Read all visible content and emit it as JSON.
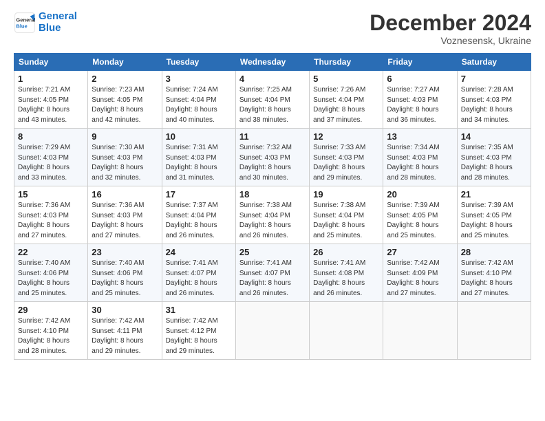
{
  "header": {
    "logo_line1": "General",
    "logo_line2": "Blue",
    "month_title": "December 2024",
    "subtitle": "Voznesensk, Ukraine"
  },
  "days_of_week": [
    "Sunday",
    "Monday",
    "Tuesday",
    "Wednesday",
    "Thursday",
    "Friday",
    "Saturday"
  ],
  "weeks": [
    [
      {
        "day": "1",
        "info": "Sunrise: 7:21 AM\nSunset: 4:05 PM\nDaylight: 8 hours\nand 43 minutes."
      },
      {
        "day": "2",
        "info": "Sunrise: 7:23 AM\nSunset: 4:05 PM\nDaylight: 8 hours\nand 42 minutes."
      },
      {
        "day": "3",
        "info": "Sunrise: 7:24 AM\nSunset: 4:04 PM\nDaylight: 8 hours\nand 40 minutes."
      },
      {
        "day": "4",
        "info": "Sunrise: 7:25 AM\nSunset: 4:04 PM\nDaylight: 8 hours\nand 38 minutes."
      },
      {
        "day": "5",
        "info": "Sunrise: 7:26 AM\nSunset: 4:04 PM\nDaylight: 8 hours\nand 37 minutes."
      },
      {
        "day": "6",
        "info": "Sunrise: 7:27 AM\nSunset: 4:03 PM\nDaylight: 8 hours\nand 36 minutes."
      },
      {
        "day": "7",
        "info": "Sunrise: 7:28 AM\nSunset: 4:03 PM\nDaylight: 8 hours\nand 34 minutes."
      }
    ],
    [
      {
        "day": "8",
        "info": "Sunrise: 7:29 AM\nSunset: 4:03 PM\nDaylight: 8 hours\nand 33 minutes."
      },
      {
        "day": "9",
        "info": "Sunrise: 7:30 AM\nSunset: 4:03 PM\nDaylight: 8 hours\nand 32 minutes."
      },
      {
        "day": "10",
        "info": "Sunrise: 7:31 AM\nSunset: 4:03 PM\nDaylight: 8 hours\nand 31 minutes."
      },
      {
        "day": "11",
        "info": "Sunrise: 7:32 AM\nSunset: 4:03 PM\nDaylight: 8 hours\nand 30 minutes."
      },
      {
        "day": "12",
        "info": "Sunrise: 7:33 AM\nSunset: 4:03 PM\nDaylight: 8 hours\nand 29 minutes."
      },
      {
        "day": "13",
        "info": "Sunrise: 7:34 AM\nSunset: 4:03 PM\nDaylight: 8 hours\nand 28 minutes."
      },
      {
        "day": "14",
        "info": "Sunrise: 7:35 AM\nSunset: 4:03 PM\nDaylight: 8 hours\nand 28 minutes."
      }
    ],
    [
      {
        "day": "15",
        "info": "Sunrise: 7:36 AM\nSunset: 4:03 PM\nDaylight: 8 hours\nand 27 minutes."
      },
      {
        "day": "16",
        "info": "Sunrise: 7:36 AM\nSunset: 4:03 PM\nDaylight: 8 hours\nand 27 minutes."
      },
      {
        "day": "17",
        "info": "Sunrise: 7:37 AM\nSunset: 4:04 PM\nDaylight: 8 hours\nand 26 minutes."
      },
      {
        "day": "18",
        "info": "Sunrise: 7:38 AM\nSunset: 4:04 PM\nDaylight: 8 hours\nand 26 minutes."
      },
      {
        "day": "19",
        "info": "Sunrise: 7:38 AM\nSunset: 4:04 PM\nDaylight: 8 hours\nand 25 minutes."
      },
      {
        "day": "20",
        "info": "Sunrise: 7:39 AM\nSunset: 4:05 PM\nDaylight: 8 hours\nand 25 minutes."
      },
      {
        "day": "21",
        "info": "Sunrise: 7:39 AM\nSunset: 4:05 PM\nDaylight: 8 hours\nand 25 minutes."
      }
    ],
    [
      {
        "day": "22",
        "info": "Sunrise: 7:40 AM\nSunset: 4:06 PM\nDaylight: 8 hours\nand 25 minutes."
      },
      {
        "day": "23",
        "info": "Sunrise: 7:40 AM\nSunset: 4:06 PM\nDaylight: 8 hours\nand 25 minutes."
      },
      {
        "day": "24",
        "info": "Sunrise: 7:41 AM\nSunset: 4:07 PM\nDaylight: 8 hours\nand 26 minutes."
      },
      {
        "day": "25",
        "info": "Sunrise: 7:41 AM\nSunset: 4:07 PM\nDaylight: 8 hours\nand 26 minutes."
      },
      {
        "day": "26",
        "info": "Sunrise: 7:41 AM\nSunset: 4:08 PM\nDaylight: 8 hours\nand 26 minutes."
      },
      {
        "day": "27",
        "info": "Sunrise: 7:42 AM\nSunset: 4:09 PM\nDaylight: 8 hours\nand 27 minutes."
      },
      {
        "day": "28",
        "info": "Sunrise: 7:42 AM\nSunset: 4:10 PM\nDaylight: 8 hours\nand 27 minutes."
      }
    ],
    [
      {
        "day": "29",
        "info": "Sunrise: 7:42 AM\nSunset: 4:10 PM\nDaylight: 8 hours\nand 28 minutes."
      },
      {
        "day": "30",
        "info": "Sunrise: 7:42 AM\nSunset: 4:11 PM\nDaylight: 8 hours\nand 29 minutes."
      },
      {
        "day": "31",
        "info": "Sunrise: 7:42 AM\nSunset: 4:12 PM\nDaylight: 8 hours\nand 29 minutes."
      },
      {
        "day": "",
        "info": ""
      },
      {
        "day": "",
        "info": ""
      },
      {
        "day": "",
        "info": ""
      },
      {
        "day": "",
        "info": ""
      }
    ]
  ]
}
